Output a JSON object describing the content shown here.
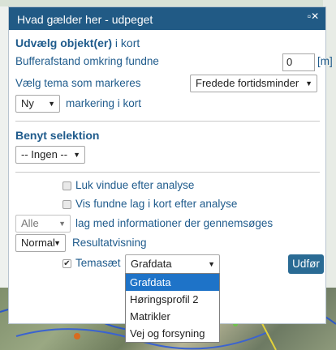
{
  "dialog": {
    "title": "Hvad gælder her - udpeget",
    "close_icon": "minimize-close-icon"
  },
  "section1": {
    "heading_bold": "Udvælg objekt(er)",
    "heading_thin": " i kort",
    "buffer_label": "Bufferafstand omkring fundne",
    "buffer_value": "0",
    "buffer_unit": "[m]",
    "tema_label": "Vælg tema som markeres",
    "tema_value": "Fredede fortidsminder",
    "marker_value": "Ny",
    "marker_label": "markering i kort"
  },
  "section2": {
    "heading": "Benyt selektion",
    "selection_value": "-- Ingen --"
  },
  "options": {
    "close_window_label": "Luk vindue efter analyse",
    "close_window_checked": false,
    "show_layer_label": "Vis fundne lag i kort efter analyse",
    "show_layer_checked": false,
    "layers_value": "Alle",
    "layers_label": "lag med informationer der gennemsøges",
    "result_value": "Normal",
    "result_label": "Resultatvisning",
    "temaset_checked": true,
    "temaset_label": "Temasæt",
    "temaset_value": "Grafdata",
    "run_button": "Udfør"
  },
  "temaset_dropdown": {
    "items": [
      "Grafdata",
      "Høringsprofil 2",
      "Matrikler",
      "Vej og forsyning"
    ],
    "selected_index": 0
  },
  "colors": {
    "titlebar": "#215a85",
    "label_blue": "#1f5b8c",
    "button": "#2a6b94",
    "highlight": "#1e73c8"
  }
}
